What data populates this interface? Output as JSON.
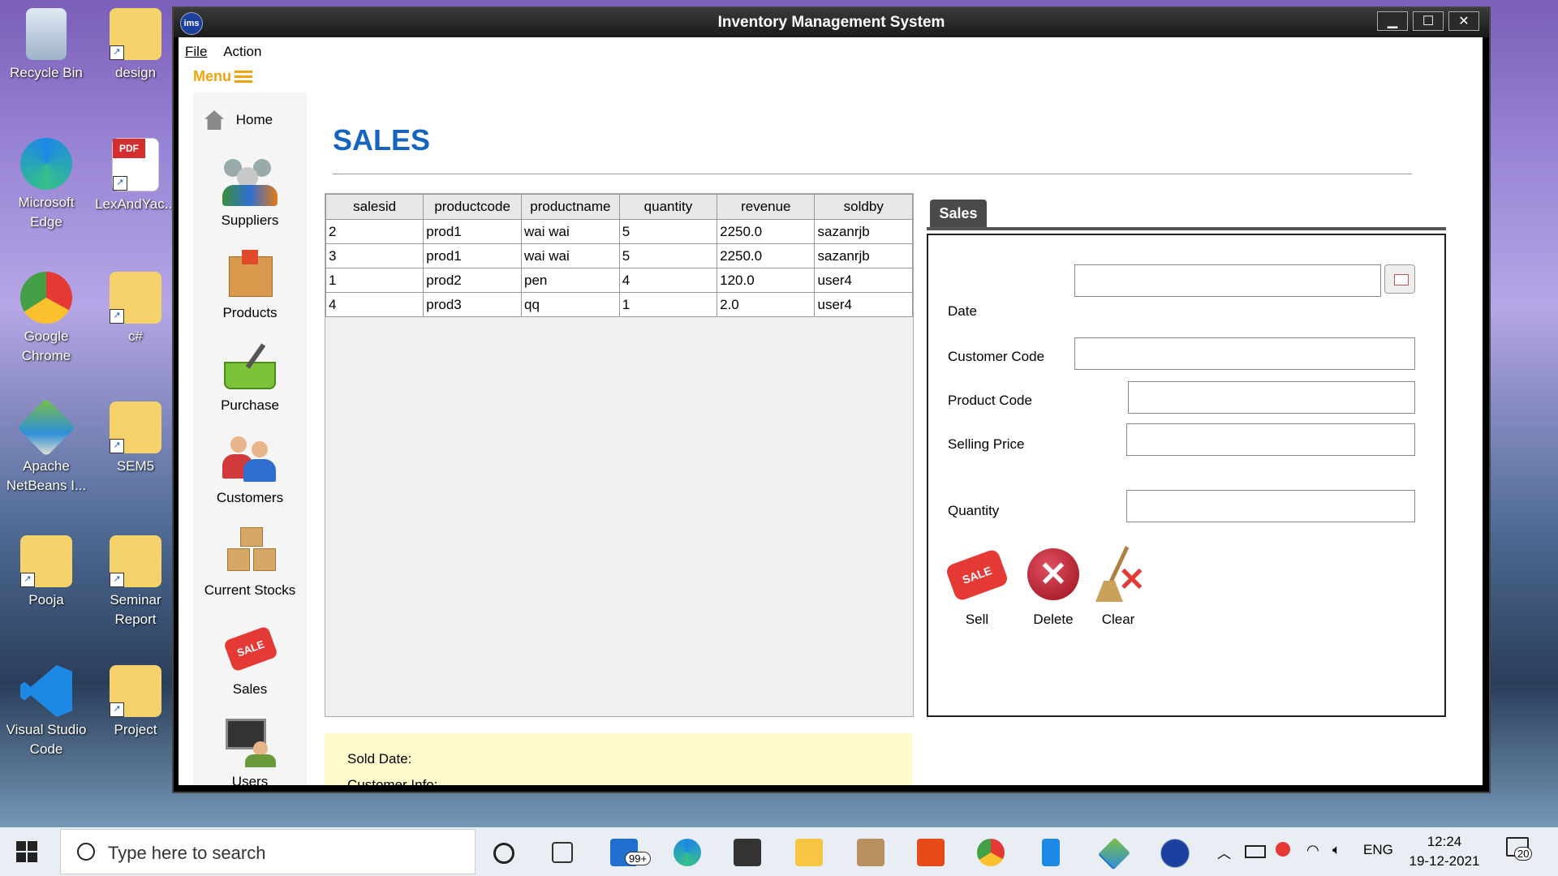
{
  "desktop": {
    "icons": [
      {
        "label": "Recycle Bin"
      },
      {
        "label": "design"
      },
      {
        "label": "Microsoft Edge"
      },
      {
        "label": "LexAndYac..."
      },
      {
        "label": "Google Chrome"
      },
      {
        "label": "c#"
      },
      {
        "label": "Apache NetBeans I..."
      },
      {
        "label": "SEM5"
      },
      {
        "label": "Pooja"
      },
      {
        "label": "Seminar Report"
      },
      {
        "label": "Visual Studio Code"
      },
      {
        "label": "Project"
      }
    ]
  },
  "window": {
    "title": "Inventory Management System",
    "logo_text": "ims",
    "controls": {
      "minimize": "▁",
      "maximize": "☐",
      "close": "✕"
    }
  },
  "menubar": {
    "file": "File",
    "action": "Action"
  },
  "menu_toggle": {
    "label": "Menu"
  },
  "sidebar": {
    "items": [
      {
        "label": "Home",
        "icon": "home-icon"
      },
      {
        "label": "Suppliers",
        "icon": "suppliers-icon"
      },
      {
        "label": "Products",
        "icon": "products-icon"
      },
      {
        "label": "Purchase",
        "icon": "purchase-icon"
      },
      {
        "label": "Customers",
        "icon": "customers-icon"
      },
      {
        "label": "Current Stocks",
        "icon": "stocks-icon"
      },
      {
        "label": "Sales",
        "icon": "sale-tag-icon"
      },
      {
        "label": "Users",
        "icon": "users-icon"
      }
    ]
  },
  "page": {
    "title": "SALES"
  },
  "table": {
    "columns": [
      "salesid",
      "productcode",
      "productname",
      "quantity",
      "revenue",
      "soldby"
    ],
    "rows": [
      [
        "2",
        "prod1",
        "wai wai",
        "5",
        "2250.0",
        "sazanrjb"
      ],
      [
        "3",
        "prod1",
        "wai wai",
        "5",
        "2250.0",
        "sazanrjb"
      ],
      [
        "1",
        "prod2",
        "pen",
        "4",
        "120.0",
        "user4"
      ],
      [
        "4",
        "prod3",
        "qq",
        "1",
        "2.0",
        "user4"
      ]
    ]
  },
  "info": {
    "sold_date": "Sold Date:",
    "customer_info": "Customer Info:"
  },
  "form": {
    "tab": "Sales",
    "labels": {
      "date": "Date",
      "customer_code": "Customer Code",
      "product_code": "Product Code",
      "selling_price": "Selling Price",
      "quantity": "Quantity"
    },
    "values": {
      "date": "",
      "customer_code": "",
      "product_code": "",
      "selling_price": "",
      "quantity": ""
    },
    "actions": {
      "sell": "Sell",
      "delete": "Delete",
      "clear": "Clear"
    }
  },
  "taskbar": {
    "search_placeholder": "Type here to search",
    "mail_badge": "99+",
    "language": "ENG",
    "time": "12:24",
    "date": "19-12-2021",
    "notification_count": "20"
  },
  "colors": {
    "title_blue": "#1565c0",
    "menu_orange": "#f2a20c",
    "info_yellow": "#fffbcc"
  }
}
